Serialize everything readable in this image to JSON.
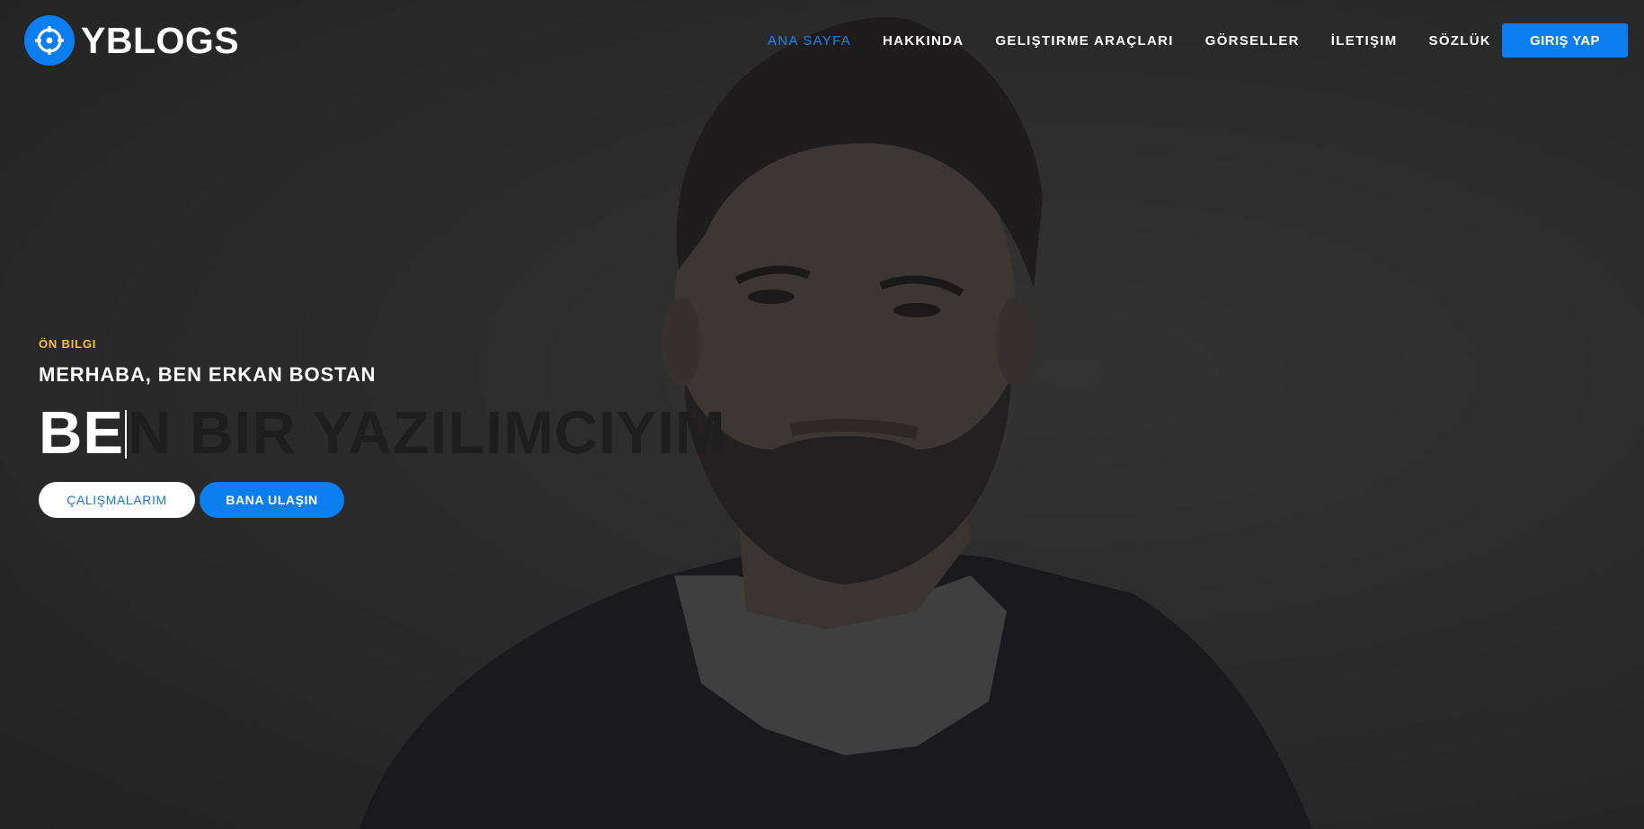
{
  "brand": {
    "name": "YBLOGS",
    "icon": "crosshair-icon",
    "accent_color": "#0d7ef0"
  },
  "nav": {
    "items": [
      {
        "label": "ANA SAYFA",
        "active": true
      },
      {
        "label": "HAKKINDA",
        "active": false
      },
      {
        "label": "GELIŞTIRME ARAÇLARI",
        "active": false
      },
      {
        "label": "GÖRSELLER",
        "active": false
      },
      {
        "label": "İLETIŞIM",
        "active": false
      },
      {
        "label": "SÖZLÜK",
        "active": false
      }
    ],
    "login_label": "GIRIŞ YAP"
  },
  "hero": {
    "eyebrow": "ÖN BILGI",
    "greeting": "MERHABA, BEN ERKAN BOSTAN",
    "typed_visible": "BE",
    "typed_faded": "N BIR YAZILIMCIYIM",
    "eyebrow_color": "#f5c518",
    "buttons": {
      "works_label": "ÇALIŞMALARIM",
      "contact_label": "BANA ULAŞIN"
    }
  }
}
